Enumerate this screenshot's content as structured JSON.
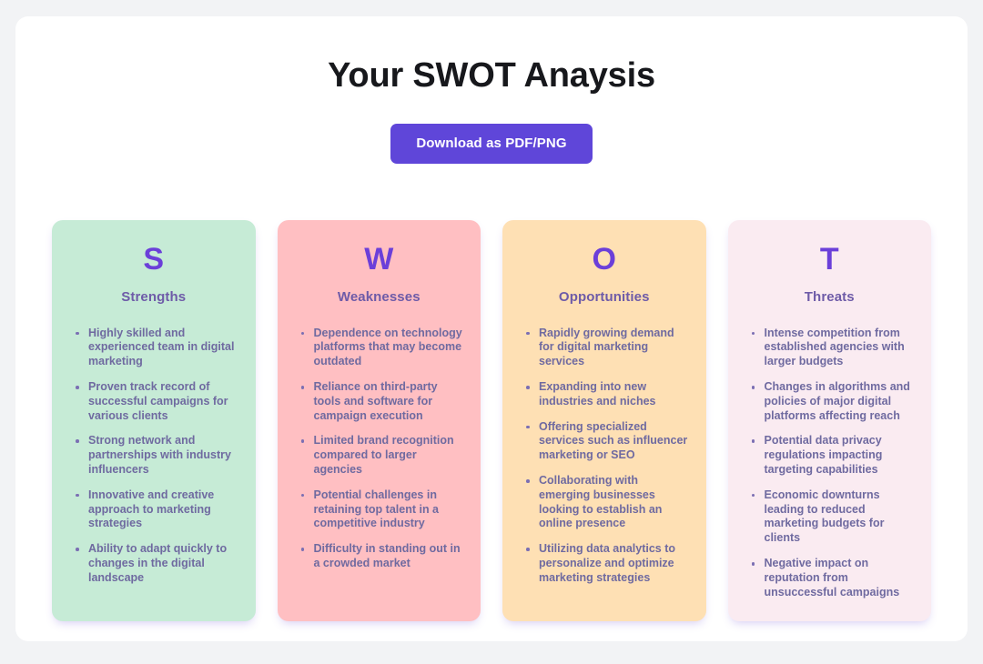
{
  "header": {
    "title": "Your SWOT Anaysis",
    "download_button_label": "Download as PDF/PNG"
  },
  "colors": {
    "page_background": "#f2f3f5",
    "panel_background": "#ffffff",
    "accent_purple": "#5f46d9",
    "letter_purple": "#6b3fd9",
    "heading_purple": "#6e5ba8",
    "body_text": "#6f6aa0",
    "title_text": "#17181c"
  },
  "cards": [
    {
      "letter": "S",
      "heading": "Strengths",
      "background": "#c6ebd6",
      "items": [
        "Highly skilled and experienced team in digital marketing",
        "Proven track record of successful campaigns for various clients",
        "Strong network and partnerships with industry influencers",
        "Innovative and creative approach to marketing strategies",
        "Ability to adapt quickly to changes in the digital landscape"
      ]
    },
    {
      "letter": "W",
      "heading": "Weaknesses",
      "background": "#ffbfc2",
      "items": [
        "Dependence on technology platforms that may become outdated",
        "Reliance on third-party tools and software for campaign execution",
        "Limited brand recognition compared to larger agencies",
        "Potential challenges in retaining top talent in a competitive industry",
        "Difficulty in standing out in a crowded market"
      ]
    },
    {
      "letter": "O",
      "heading": "Opportunities",
      "background": "#fee0b4",
      "items": [
        "Rapidly growing demand for digital marketing services",
        "Expanding into new industries and niches",
        "Offering specialized services such as influencer marketing or SEO",
        "Collaborating with emerging businesses looking to establish an online presence",
        "Utilizing data analytics to personalize and optimize marketing strategies"
      ]
    },
    {
      "letter": "T",
      "heading": "Threats",
      "background": "#faebf1",
      "items": [
        "Intense competition from established agencies with larger budgets",
        "Changes in algorithms and policies of major digital platforms affecting reach",
        "Potential data privacy regulations impacting targeting capabilities",
        "Economic downturns leading to reduced marketing budgets for clients",
        "Negative impact on reputation from unsuccessful campaigns"
      ]
    }
  ]
}
